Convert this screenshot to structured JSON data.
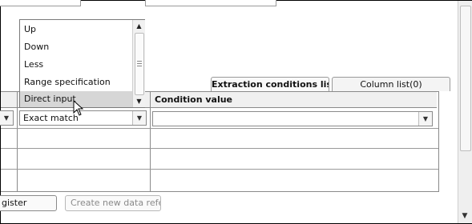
{
  "tabs": [
    {
      "label": "Extraction conditions lis",
      "active": true
    },
    {
      "label": "Column list(0)",
      "active": false
    }
  ],
  "grid": {
    "headers": [
      "",
      "",
      "Condition value"
    ],
    "row1": {
      "left_value": "",
      "operator_value": "Exact match",
      "condition_value": ""
    }
  },
  "dropdown": {
    "items": [
      "Up",
      "Down",
      "Less",
      "Range specification",
      "Direct input"
    ],
    "highlighted": "Direct input"
  },
  "buttons": {
    "register": "gister",
    "create": "Create new data refere"
  },
  "icons": {
    "combo_arrow": "chevron-down-icon",
    "scroll_up": "scroll-up-icon",
    "scroll_down": "scroll-down-icon",
    "cursor": "mouse-pointer-icon"
  }
}
